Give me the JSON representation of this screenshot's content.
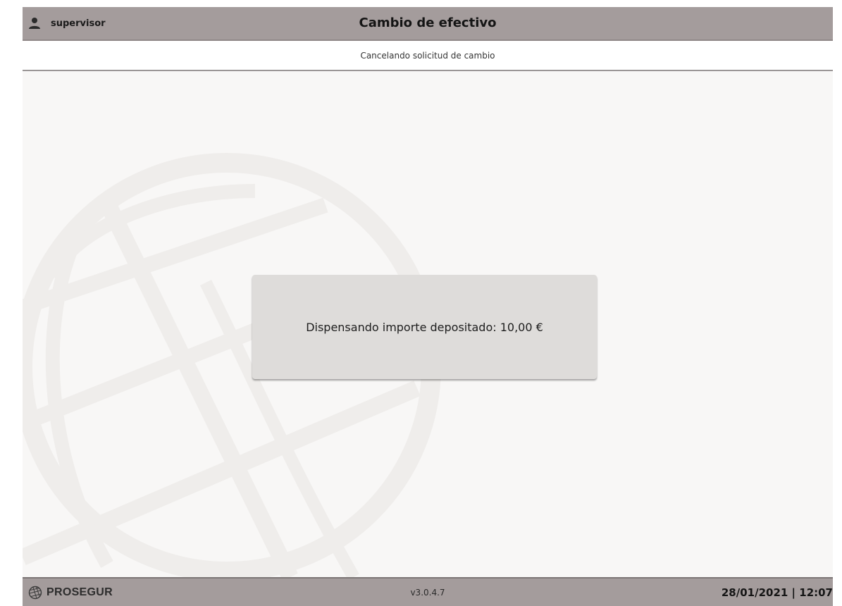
{
  "header": {
    "user_icon": "user-icon",
    "username": "supervisor",
    "title": "Cambio de efectivo"
  },
  "subheader": {
    "status_text": "Cancelando solicitud de cambio"
  },
  "dialog": {
    "message": "Dispensando importe depositado: 10,00 €"
  },
  "footer": {
    "brand_icon": "globe-icon",
    "brand": "PROSEGUR",
    "version": "v3.0.4.7",
    "datetime": "28/01/2021 | 12:07"
  },
  "colors": {
    "bar_background": "#a49c9c",
    "screen_background": "#f8f7f6",
    "dialog_background": "#dedcda",
    "watermark": "#efedeb"
  }
}
